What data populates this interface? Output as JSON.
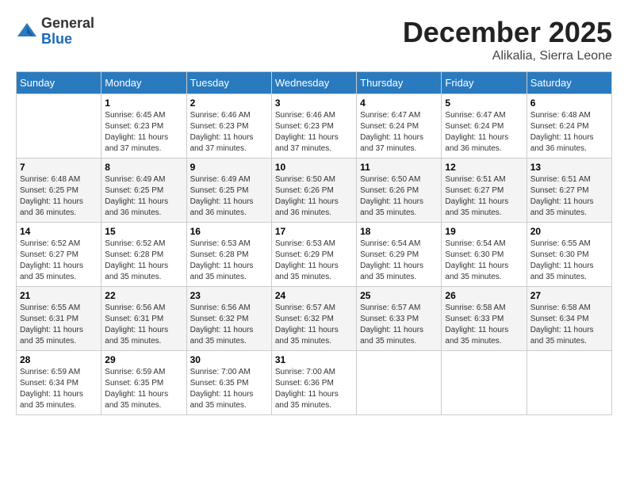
{
  "logo": {
    "general": "General",
    "blue": "Blue"
  },
  "title": "December 2025",
  "location": "Alikalia, Sierra Leone",
  "days_of_week": [
    "Sunday",
    "Monday",
    "Tuesday",
    "Wednesday",
    "Thursday",
    "Friday",
    "Saturday"
  ],
  "weeks": [
    [
      {
        "day": "",
        "sunrise": "",
        "sunset": "",
        "daylight": ""
      },
      {
        "day": "1",
        "sunrise": "Sunrise: 6:45 AM",
        "sunset": "Sunset: 6:23 PM",
        "daylight": "Daylight: 11 hours and 37 minutes."
      },
      {
        "day": "2",
        "sunrise": "Sunrise: 6:46 AM",
        "sunset": "Sunset: 6:23 PM",
        "daylight": "Daylight: 11 hours and 37 minutes."
      },
      {
        "day": "3",
        "sunrise": "Sunrise: 6:46 AM",
        "sunset": "Sunset: 6:23 PM",
        "daylight": "Daylight: 11 hours and 37 minutes."
      },
      {
        "day": "4",
        "sunrise": "Sunrise: 6:47 AM",
        "sunset": "Sunset: 6:24 PM",
        "daylight": "Daylight: 11 hours and 37 minutes."
      },
      {
        "day": "5",
        "sunrise": "Sunrise: 6:47 AM",
        "sunset": "Sunset: 6:24 PM",
        "daylight": "Daylight: 11 hours and 36 minutes."
      },
      {
        "day": "6",
        "sunrise": "Sunrise: 6:48 AM",
        "sunset": "Sunset: 6:24 PM",
        "daylight": "Daylight: 11 hours and 36 minutes."
      }
    ],
    [
      {
        "day": "7",
        "sunrise": "Sunrise: 6:48 AM",
        "sunset": "Sunset: 6:25 PM",
        "daylight": "Daylight: 11 hours and 36 minutes."
      },
      {
        "day": "8",
        "sunrise": "Sunrise: 6:49 AM",
        "sunset": "Sunset: 6:25 PM",
        "daylight": "Daylight: 11 hours and 36 minutes."
      },
      {
        "day": "9",
        "sunrise": "Sunrise: 6:49 AM",
        "sunset": "Sunset: 6:25 PM",
        "daylight": "Daylight: 11 hours and 36 minutes."
      },
      {
        "day": "10",
        "sunrise": "Sunrise: 6:50 AM",
        "sunset": "Sunset: 6:26 PM",
        "daylight": "Daylight: 11 hours and 36 minutes."
      },
      {
        "day": "11",
        "sunrise": "Sunrise: 6:50 AM",
        "sunset": "Sunset: 6:26 PM",
        "daylight": "Daylight: 11 hours and 35 minutes."
      },
      {
        "day": "12",
        "sunrise": "Sunrise: 6:51 AM",
        "sunset": "Sunset: 6:27 PM",
        "daylight": "Daylight: 11 hours and 35 minutes."
      },
      {
        "day": "13",
        "sunrise": "Sunrise: 6:51 AM",
        "sunset": "Sunset: 6:27 PM",
        "daylight": "Daylight: 11 hours and 35 minutes."
      }
    ],
    [
      {
        "day": "14",
        "sunrise": "Sunrise: 6:52 AM",
        "sunset": "Sunset: 6:27 PM",
        "daylight": "Daylight: 11 hours and 35 minutes."
      },
      {
        "day": "15",
        "sunrise": "Sunrise: 6:52 AM",
        "sunset": "Sunset: 6:28 PM",
        "daylight": "Daylight: 11 hours and 35 minutes."
      },
      {
        "day": "16",
        "sunrise": "Sunrise: 6:53 AM",
        "sunset": "Sunset: 6:28 PM",
        "daylight": "Daylight: 11 hours and 35 minutes."
      },
      {
        "day": "17",
        "sunrise": "Sunrise: 6:53 AM",
        "sunset": "Sunset: 6:29 PM",
        "daylight": "Daylight: 11 hours and 35 minutes."
      },
      {
        "day": "18",
        "sunrise": "Sunrise: 6:54 AM",
        "sunset": "Sunset: 6:29 PM",
        "daylight": "Daylight: 11 hours and 35 minutes."
      },
      {
        "day": "19",
        "sunrise": "Sunrise: 6:54 AM",
        "sunset": "Sunset: 6:30 PM",
        "daylight": "Daylight: 11 hours and 35 minutes."
      },
      {
        "day": "20",
        "sunrise": "Sunrise: 6:55 AM",
        "sunset": "Sunset: 6:30 PM",
        "daylight": "Daylight: 11 hours and 35 minutes."
      }
    ],
    [
      {
        "day": "21",
        "sunrise": "Sunrise: 6:55 AM",
        "sunset": "Sunset: 6:31 PM",
        "daylight": "Daylight: 11 hours and 35 minutes."
      },
      {
        "day": "22",
        "sunrise": "Sunrise: 6:56 AM",
        "sunset": "Sunset: 6:31 PM",
        "daylight": "Daylight: 11 hours and 35 minutes."
      },
      {
        "day": "23",
        "sunrise": "Sunrise: 6:56 AM",
        "sunset": "Sunset: 6:32 PM",
        "daylight": "Daylight: 11 hours and 35 minutes."
      },
      {
        "day": "24",
        "sunrise": "Sunrise: 6:57 AM",
        "sunset": "Sunset: 6:32 PM",
        "daylight": "Daylight: 11 hours and 35 minutes."
      },
      {
        "day": "25",
        "sunrise": "Sunrise: 6:57 AM",
        "sunset": "Sunset: 6:33 PM",
        "daylight": "Daylight: 11 hours and 35 minutes."
      },
      {
        "day": "26",
        "sunrise": "Sunrise: 6:58 AM",
        "sunset": "Sunset: 6:33 PM",
        "daylight": "Daylight: 11 hours and 35 minutes."
      },
      {
        "day": "27",
        "sunrise": "Sunrise: 6:58 AM",
        "sunset": "Sunset: 6:34 PM",
        "daylight": "Daylight: 11 hours and 35 minutes."
      }
    ],
    [
      {
        "day": "28",
        "sunrise": "Sunrise: 6:59 AM",
        "sunset": "Sunset: 6:34 PM",
        "daylight": "Daylight: 11 hours and 35 minutes."
      },
      {
        "day": "29",
        "sunrise": "Sunrise: 6:59 AM",
        "sunset": "Sunset: 6:35 PM",
        "daylight": "Daylight: 11 hours and 35 minutes."
      },
      {
        "day": "30",
        "sunrise": "Sunrise: 7:00 AM",
        "sunset": "Sunset: 6:35 PM",
        "daylight": "Daylight: 11 hours and 35 minutes."
      },
      {
        "day": "31",
        "sunrise": "Sunrise: 7:00 AM",
        "sunset": "Sunset: 6:36 PM",
        "daylight": "Daylight: 11 hours and 35 minutes."
      },
      {
        "day": "",
        "sunrise": "",
        "sunset": "",
        "daylight": ""
      },
      {
        "day": "",
        "sunrise": "",
        "sunset": "",
        "daylight": ""
      },
      {
        "day": "",
        "sunrise": "",
        "sunset": "",
        "daylight": ""
      }
    ]
  ]
}
